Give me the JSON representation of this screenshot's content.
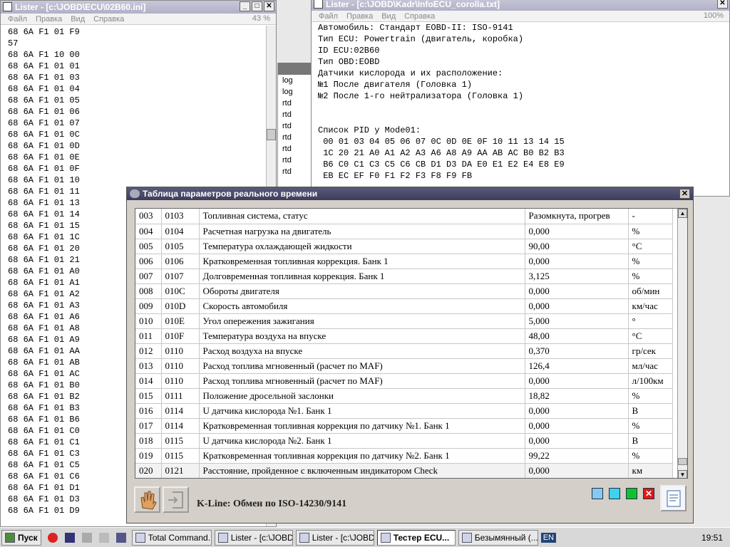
{
  "lister_left": {
    "title": "Lister - [c:\\JOBD\\ECU\\02B60.ini]",
    "menu": [
      "Файл",
      "Правка",
      "Вид",
      "Справка"
    ],
    "percent": "43 %",
    "lines": [
      "68 6A F1 01 F9",
      "57",
      "68 6A F1 10 00",
      "68 6A F1 01 01",
      "68 6A F1 01 03",
      "68 6A F1 01 04",
      "68 6A F1 01 05",
      "68 6A F1 01 06",
      "68 6A F1 01 07",
      "68 6A F1 01 0C",
      "68 6A F1 01 0D",
      "68 6A F1 01 0E",
      "68 6A F1 01 0F",
      "68 6A F1 01 10",
      "68 6A F1 01 11",
      "68 6A F1 01 13",
      "68 6A F1 01 14",
      "68 6A F1 01 15",
      "68 6A F1 01 1C",
      "68 6A F1 01 20",
      "68 6A F1 01 21",
      "68 6A F1 01 A0",
      "68 6A F1 01 A1",
      "68 6A F1 01 A2",
      "68 6A F1 01 A3",
      "68 6A F1 01 A6",
      "68 6A F1 01 A8",
      "68 6A F1 01 A9",
      "68 6A F1 01 AA",
      "68 6A F1 01 AB",
      "68 6A F1 01 AC",
      "68 6A F1 01 B0",
      "68 6A F1 01 B2",
      "68 6A F1 01 B3",
      "68 6A F1 01 B6",
      "68 6A F1 01 C0",
      "68 6A F1 01 C1",
      "68 6A F1 01 C3",
      "68 6A F1 01 C5",
      "68 6A F1 01 C6",
      "68 6A F1 01 D1",
      "68 6A F1 01 D3",
      "68 6A F1 01 D9"
    ]
  },
  "middle": {
    "items": [
      "log",
      "log",
      "rtd",
      "rtd",
      "rtd",
      "rtd",
      "rtd",
      "rtd",
      "rtd"
    ]
  },
  "lister_right": {
    "title": "Lister - [c:\\JOBD\\Kadr\\InfoECU_corolla.txt]",
    "menu": [
      "Файл",
      "Правка",
      "Вид",
      "Справка"
    ],
    "percent": "100%",
    "lines": [
      "Автомобиль: Стандарт EOBD-II: ISO-9141",
      "Тип ECU: Powertrain (двигатель, коробка)",
      "ID ECU:02B60",
      "Тип OBD:EOBD",
      "Датчики кислорода и их расположение:",
      "№1 После двигателя (Головка 1)",
      "№2 После 1-го нейтрализатора (Головка 1)",
      "",
      "",
      "Список PID у Mode01:",
      " 00 01 03 04 05 06 07 0C 0D 0E 0F 10 11 13 14 15",
      " 1C 20 21 A0 A1 A2 A3 A6 A8 A9 AA AB AC B0 B2 B3",
      " B6 C0 C1 C3 C5 C6 CB D1 D3 DA E0 E1 E2 E4 E8 E9",
      " EB EC EF F0 F1 F2 F3 F8 F9 FB"
    ]
  },
  "dialog": {
    "title": "Таблица параметров реального времени",
    "close": "✕",
    "status": "K-Line: Обмен по ISO-14230/9141",
    "rows": [
      [
        "003",
        "0103",
        "Топливная система, статус",
        "Разомкнута, прогрев",
        "-"
      ],
      [
        "004",
        "0104",
        "Расчетная нагрузка на двигатель",
        "0,000",
        "%"
      ],
      [
        "005",
        "0105",
        "Температура охлаждающей жидкости",
        "90,00",
        "°C"
      ],
      [
        "006",
        "0106",
        "Кратковременная топливная коррекция. Банк 1",
        "0,000",
        "%"
      ],
      [
        "007",
        "0107",
        "Долговременная топливная коррекция. Банк 1",
        "3,125",
        "%"
      ],
      [
        "008",
        "010C",
        "Обороты двигателя",
        "0,000",
        "об/мин"
      ],
      [
        "009",
        "010D",
        "Скорость автомобиля",
        "0,000",
        "км/час"
      ],
      [
        "010",
        "010E",
        "Угол опережения зажигания",
        "5,000",
        "°"
      ],
      [
        "011",
        "010F",
        "Температура воздуха на впуске",
        "48,00",
        "°C"
      ],
      [
        "012",
        "0110",
        "Расход воздуха на впуске",
        "0,370",
        "гр/сек"
      ],
      [
        "013",
        "0110",
        "Расход топлива мгновенный (расчет по MAF)",
        "126,4",
        "мл/час"
      ],
      [
        "014",
        "0110",
        "Расход топлива мгновенный (расчет по MAF)",
        "0,000",
        "л/100км"
      ],
      [
        "015",
        "0111",
        "Положение дросельной заслонки",
        "18,82",
        "%"
      ],
      [
        "016",
        "0114",
        "U датчика кислорода №1. Банк 1",
        "0,000",
        "B"
      ],
      [
        "017",
        "0114",
        "Кратковременная топливная коррекция по датчику №1. Банк 1",
        "0,000",
        "%"
      ],
      [
        "018",
        "0115",
        "U датчика кислорода №2. Банк 1",
        "0,000",
        "B"
      ],
      [
        "019",
        "0115",
        "Кратковременная топливная коррекция по датчику №2. Банк 1",
        "99,22",
        "%"
      ],
      [
        "020",
        "0121",
        "Расстояние, пройденное с включенным индикатором Check",
        "0,000",
        "км"
      ]
    ]
  },
  "taskbar": {
    "start": "Пуск",
    "buttons": [
      "Total Command...",
      "Lister - [c:\\JOBD...",
      "Lister - [c:\\JOBD...",
      "Тестер ECU...",
      "Безымянный (..."
    ],
    "lang": "EN",
    "clock": "19:51"
  }
}
